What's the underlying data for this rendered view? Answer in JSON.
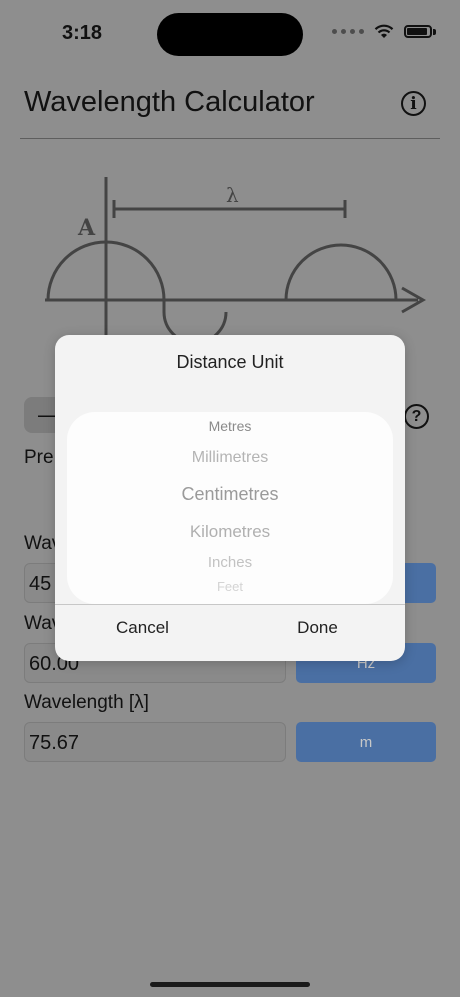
{
  "status": {
    "time": "3:18"
  },
  "header": {
    "title": "Wavelength Calculator"
  },
  "diagram": {
    "lambda_label": "λ",
    "amplitude_label": "A"
  },
  "controls": {
    "stepper_label": "—",
    "pre_label": "Pre",
    "help_symbol": "?"
  },
  "fields": {
    "velocity": {
      "label": "Wav",
      "value": "45"
    },
    "frequency": {
      "label": "Wav",
      "value": "60.00",
      "unit": "Hz"
    },
    "wavelength": {
      "label": "Wavelength [λ]",
      "value": "75.67",
      "unit": "m"
    }
  },
  "dialog": {
    "title": "Distance Unit",
    "options": [
      "Metres",
      "Millimetres",
      "Centimetres",
      "Kilometres",
      "Inches",
      "Feet"
    ],
    "selected": "Centimetres",
    "cancel_label": "Cancel",
    "done_label": "Done"
  }
}
